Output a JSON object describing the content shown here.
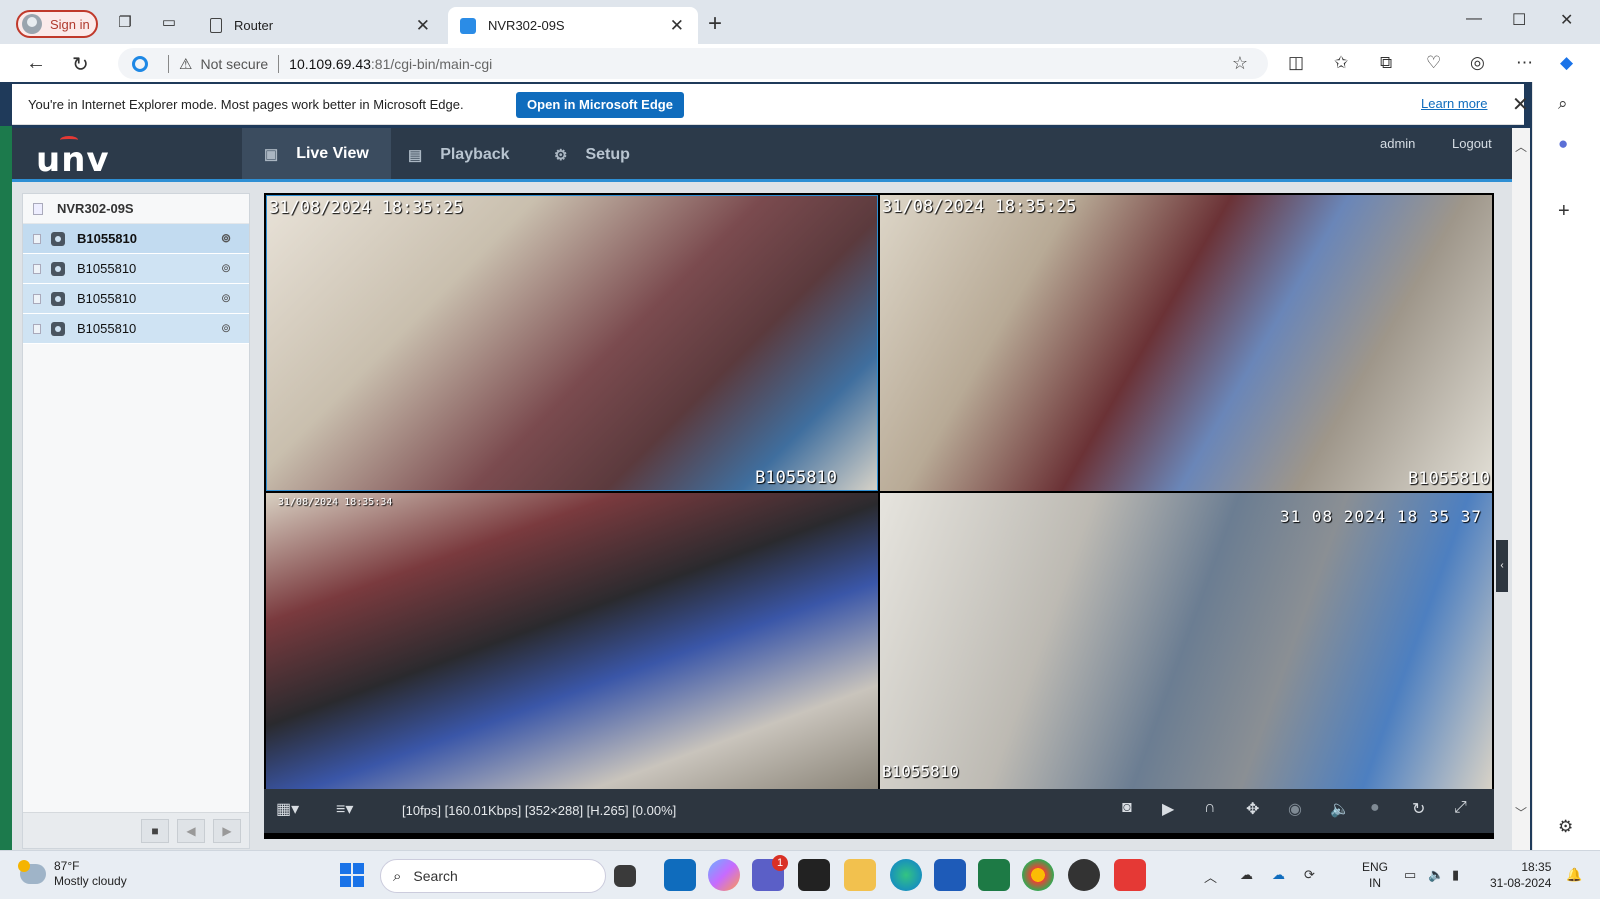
{
  "browser": {
    "signin_label": "Sign in",
    "tabs": [
      {
        "title": "Router",
        "active": false
      },
      {
        "title": "NVR302-09S",
        "active": true
      }
    ],
    "address": {
      "security_label": "Not secure",
      "url_host": "10.109.69.43",
      "url_path": ":81/cgi-bin/main-cgi"
    },
    "infobar": {
      "message": "You're in Internet Explorer mode. Most pages work better in Microsoft Edge.",
      "open_button": "Open in Microsoft Edge",
      "learn_more": "Learn more"
    }
  },
  "app": {
    "brand": "unv",
    "nav": [
      {
        "label": "Live View",
        "active": true
      },
      {
        "label": "Playback",
        "active": false
      },
      {
        "label": "Setup",
        "active": false
      }
    ],
    "user": "admin",
    "logout": "Logout",
    "device_tree": {
      "root": "NVR302-09S",
      "channels": [
        {
          "name": "B1055810",
          "selected": true
        },
        {
          "name": "B1055810",
          "selected": false
        },
        {
          "name": "B1055810",
          "selected": false
        },
        {
          "name": "B1055810",
          "selected": false
        }
      ]
    },
    "live": {
      "panes": [
        {
          "timestamp": "31/08/2024 18:35:25",
          "name": "B1055810"
        },
        {
          "timestamp": "31/08/2024 18:35:25",
          "name": "B1055810"
        },
        {
          "timestamp": "31/08/2024 18:35:34",
          "name": ""
        },
        {
          "timestamp": "31 08 2024 18 35 37",
          "name": "B1055810"
        }
      ],
      "status": "[10fps] [160.01Kbps] [352×288] [H.265] [0.00%]"
    }
  },
  "taskbar": {
    "weather_temp": "87°F",
    "weather_desc": "Mostly cloudy",
    "search_placeholder": "Search",
    "teams_badge": "1",
    "lang_top": "ENG",
    "lang_bottom": "IN",
    "time": "18:35",
    "date": "31-08-2024"
  },
  "colors": {
    "accent": "#2e8fd4",
    "header_bg": "#2c3a4a",
    "edge_button": "#0f6cbd",
    "selected_row": "#c2dbf0"
  }
}
